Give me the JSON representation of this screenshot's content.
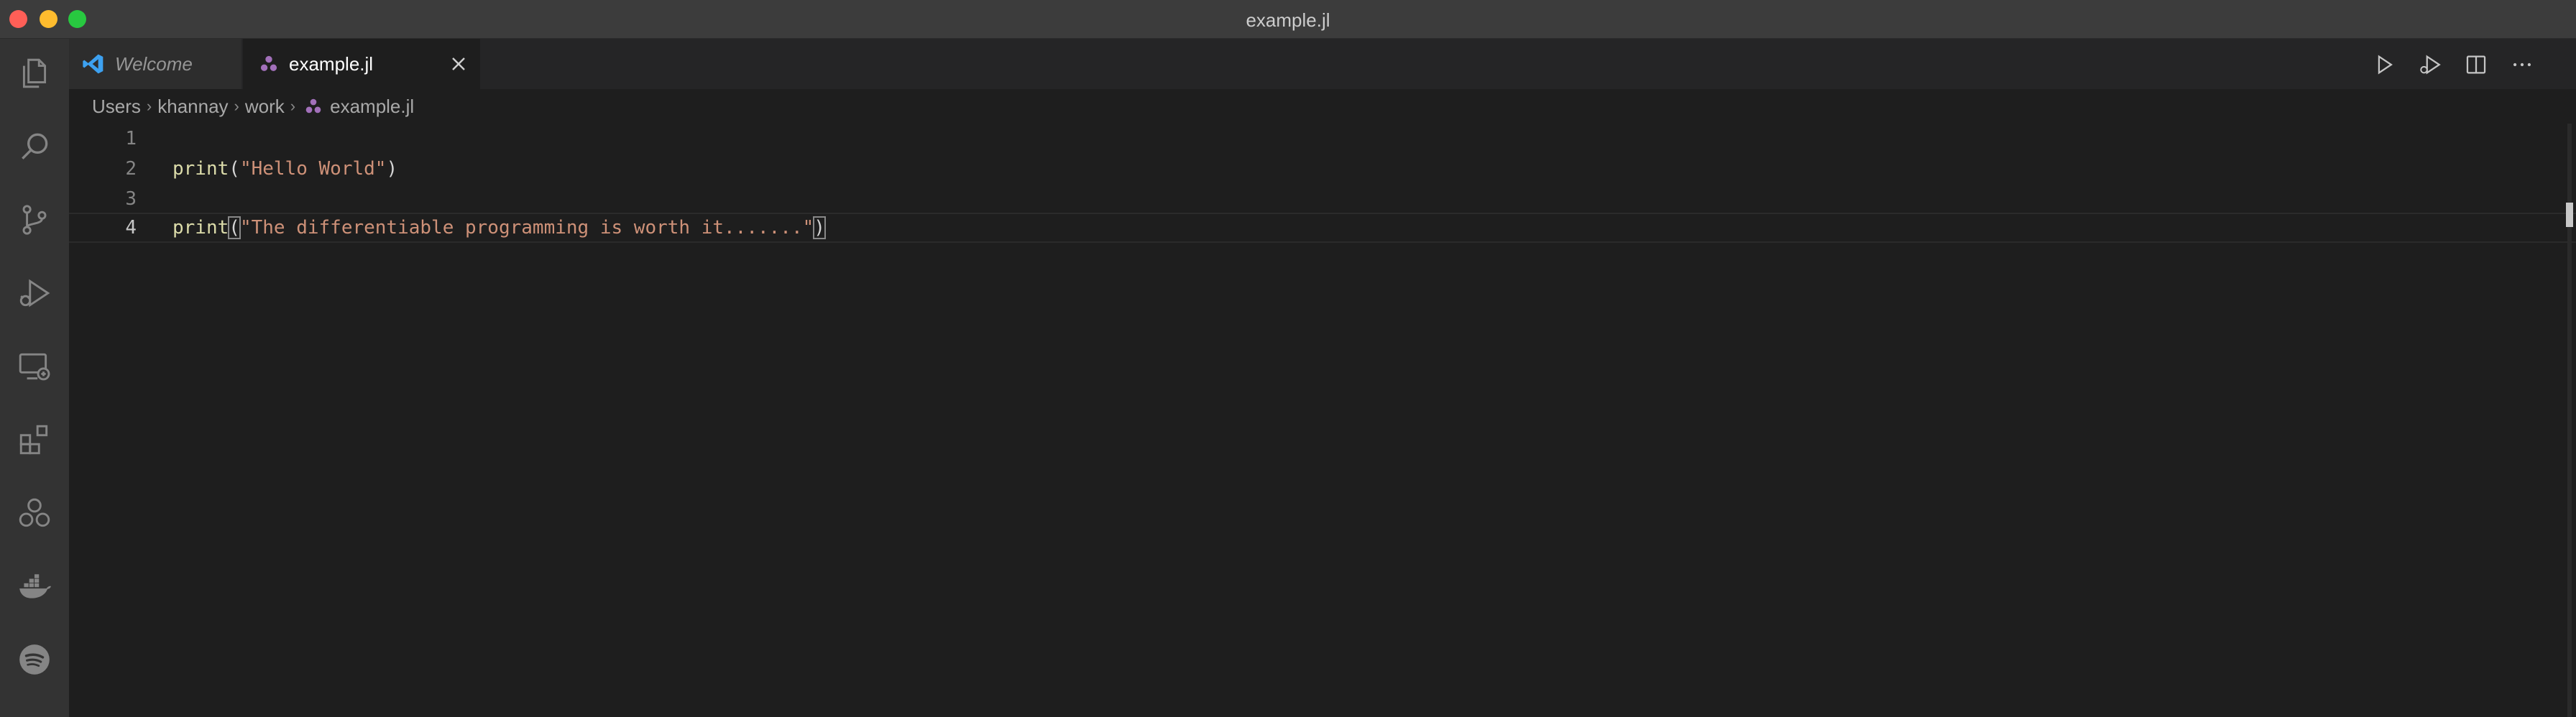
{
  "window": {
    "title": "example.jl"
  },
  "activity_bar": {
    "items": [
      "explorer-icon",
      "search-icon",
      "source-control-icon",
      "run-debug-icon",
      "remote-explorer-icon",
      "extensions-icon",
      "julia-icon",
      "docker-icon",
      "spotify-icon"
    ]
  },
  "tabs": [
    {
      "label": "Welcome",
      "icon": "vscode-logo-icon",
      "active": false
    },
    {
      "label": "example.jl",
      "icon": "julia-file-icon",
      "active": true
    }
  ],
  "editor_actions": [
    "run-icon",
    "run-debug-icon",
    "split-editor-icon",
    "more-actions-icon"
  ],
  "breadcrumb": [
    "Users",
    "khannay",
    "work",
    "example.jl"
  ],
  "editor": {
    "lines": [
      {
        "number": "1",
        "fn": "",
        "open": "",
        "str": "",
        "close": ""
      },
      {
        "number": "2",
        "fn": "print",
        "open": "(",
        "str": "\"Hello World\"",
        "close": ")"
      },
      {
        "number": "3",
        "fn": "",
        "open": "",
        "str": "",
        "close": ""
      },
      {
        "number": "4",
        "fn": "print",
        "open": "(",
        "str": "\"The differentiable programming is worth it.......\"",
        "close": ")"
      }
    ],
    "current_line": "4"
  },
  "colors": {
    "function": "#dcdcaa",
    "string": "#ce9178",
    "accent_julia": "#a270ba",
    "vscode_blue": "#3da1f0"
  }
}
